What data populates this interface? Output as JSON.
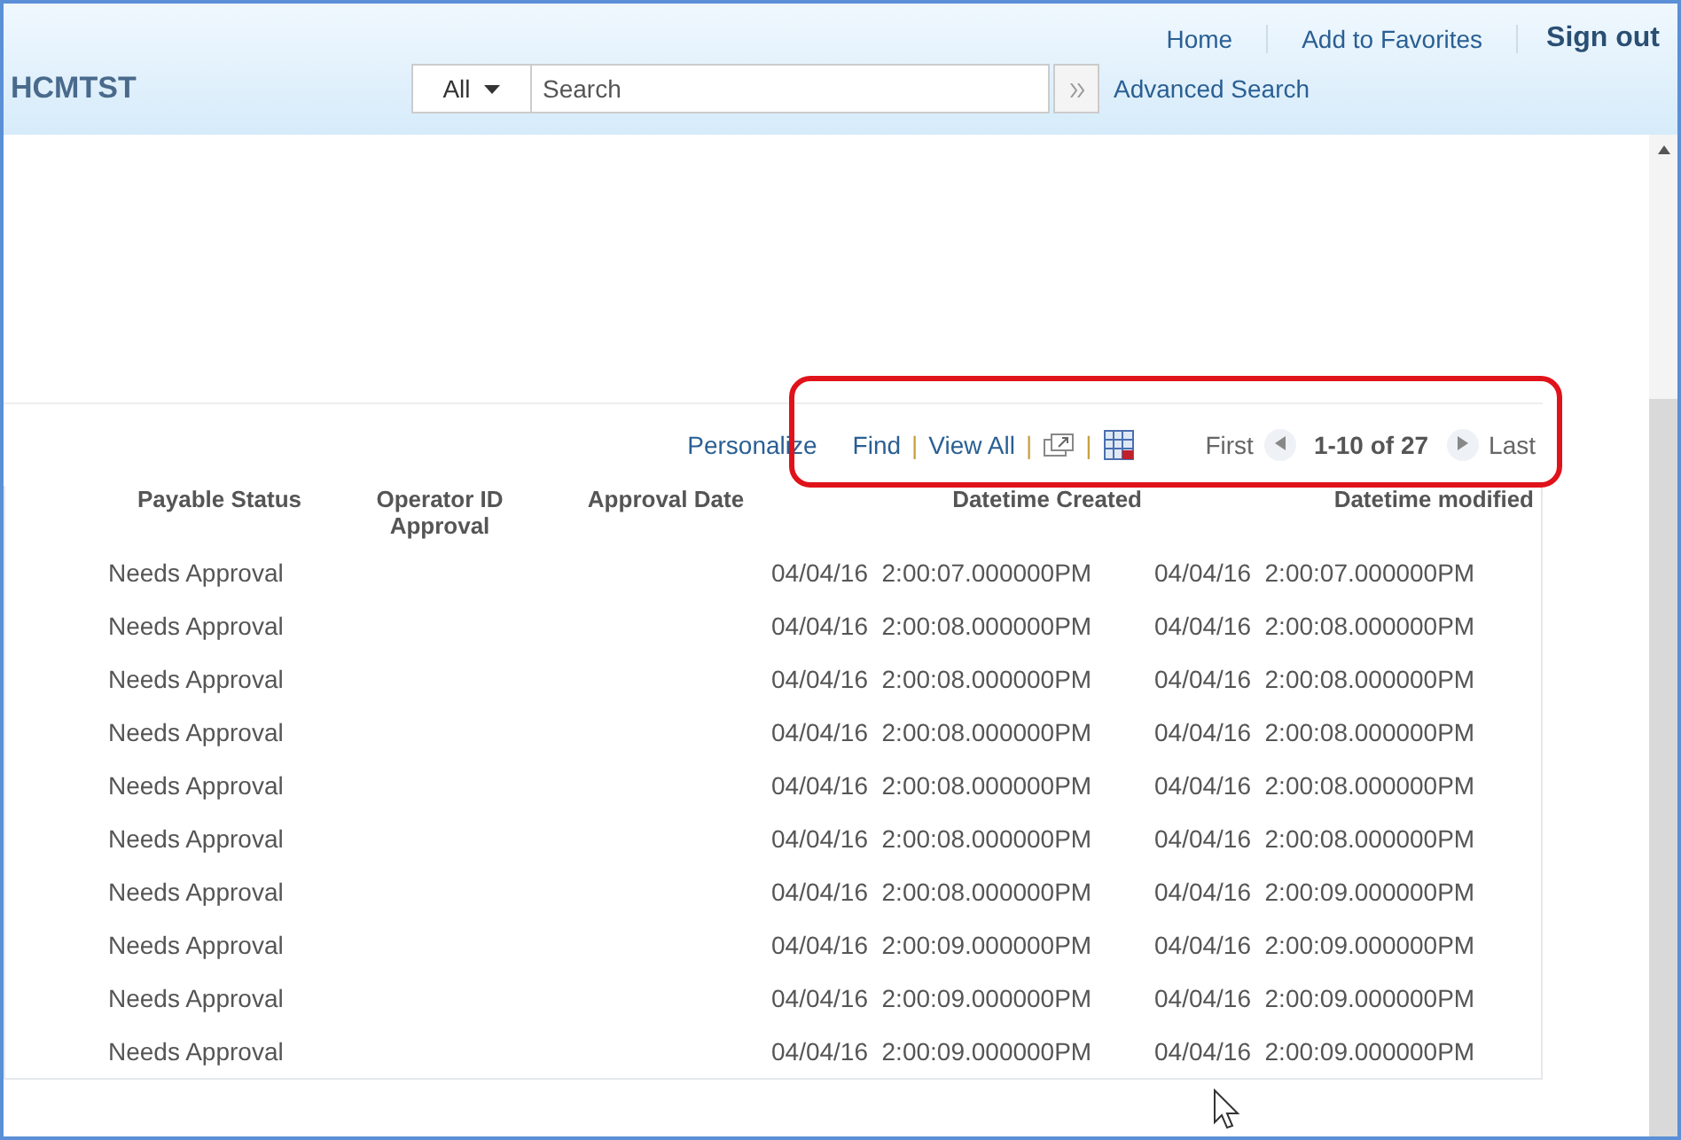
{
  "header": {
    "app_name": "HCMTST",
    "links": [
      "Home",
      "Add to Favorites"
    ],
    "sign_out": "Sign out",
    "search": {
      "scope": "All",
      "placeholder": "Search",
      "advanced": "Advanced Search"
    }
  },
  "grid_toolbar": {
    "personalize": "Personalize",
    "separators": [
      "|",
      "|",
      "|"
    ],
    "find": "Find",
    "view_all": "View All",
    "first": "First",
    "range": "1-10 of 27",
    "last": "Last"
  },
  "table": {
    "columns": [
      "Payable Status",
      "Operator ID Approval",
      "Approval Date",
      "Datetime Created",
      "Datetime modified"
    ],
    "rows": [
      {
        "status": "Needs Approval",
        "created": "04/04/16  2:00:07.000000PM",
        "modified": "04/04/16  2:00:07.000000PM"
      },
      {
        "status": "Needs Approval",
        "created": "04/04/16  2:00:08.000000PM",
        "modified": "04/04/16  2:00:08.000000PM"
      },
      {
        "status": "Needs Approval",
        "created": "04/04/16  2:00:08.000000PM",
        "modified": "04/04/16  2:00:08.000000PM"
      },
      {
        "status": "Needs Approval",
        "created": "04/04/16  2:00:08.000000PM",
        "modified": "04/04/16  2:00:08.000000PM"
      },
      {
        "status": "Needs Approval",
        "created": "04/04/16  2:00:08.000000PM",
        "modified": "04/04/16  2:00:08.000000PM"
      },
      {
        "status": "Needs Approval",
        "created": "04/04/16  2:00:08.000000PM",
        "modified": "04/04/16  2:00:08.000000PM"
      },
      {
        "status": "Needs Approval",
        "created": "04/04/16  2:00:08.000000PM",
        "modified": "04/04/16  2:00:09.000000PM"
      },
      {
        "status": "Needs Approval",
        "created": "04/04/16  2:00:09.000000PM",
        "modified": "04/04/16  2:00:09.000000PM"
      },
      {
        "status": "Needs Approval",
        "created": "04/04/16  2:00:09.000000PM",
        "modified": "04/04/16  2:00:09.000000PM"
      },
      {
        "status": "Needs Approval",
        "created": "04/04/16  2:00:09.000000PM",
        "modified": "04/04/16  2:00:09.000000PM"
      }
    ]
  }
}
